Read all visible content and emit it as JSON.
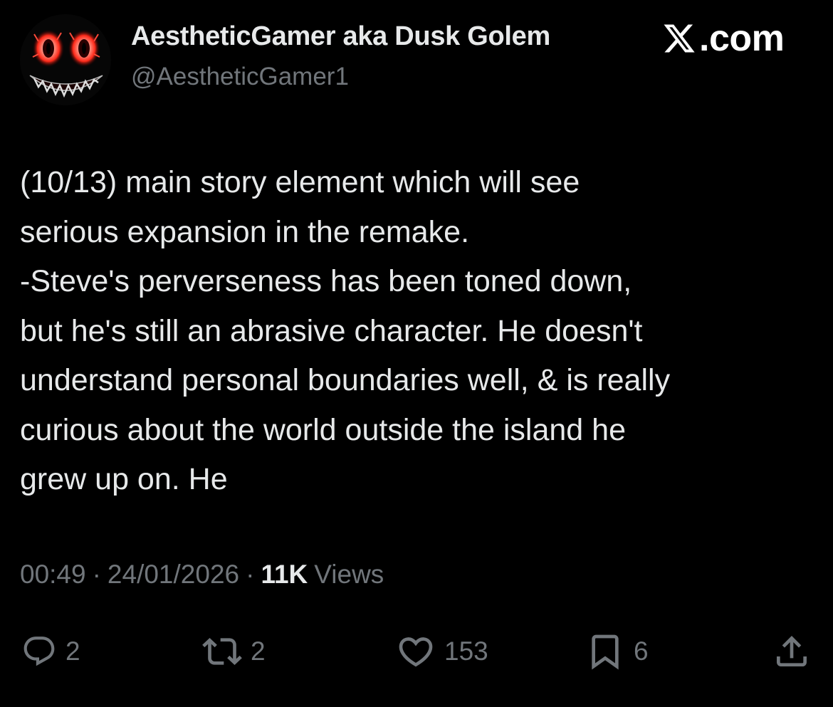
{
  "author": {
    "display_name": "AestheticGamer aka Dusk Golem",
    "handle": "@AestheticGamer1"
  },
  "brand": {
    "label": ".com",
    "icon": "x-logo-icon"
  },
  "tweet": {
    "text": "(10/13) main story element which will see\nserious expansion in the remake.\n-Steve's perverseness has been toned down,\nbut he's still an abrasive character. He doesn't\nunderstand personal boundaries well, & is really\ncurious about the world outside the island he\ngrew up on. He"
  },
  "meta": {
    "time": "00:49",
    "date": "24/01/2026",
    "views_count": "11K",
    "views_label": "Views"
  },
  "actions": {
    "replies": "2",
    "reposts": "2",
    "likes": "153",
    "bookmarks": "6"
  },
  "colors": {
    "background": "#000000",
    "primary_text": "#e7e9ea",
    "secondary_text": "#71767b",
    "avatar_accent": "#ff3b2f"
  }
}
